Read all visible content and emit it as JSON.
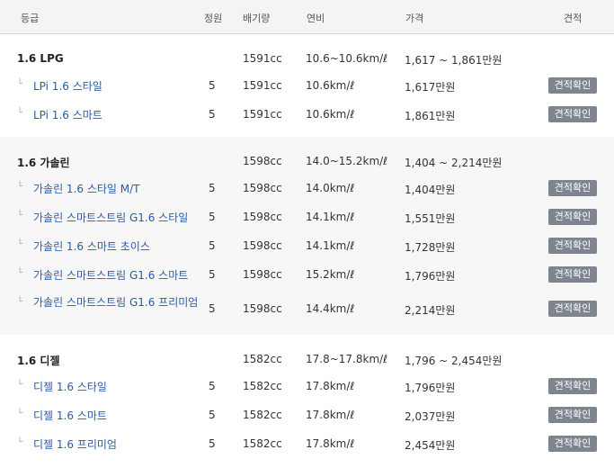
{
  "header": {
    "grade": "등급",
    "seats": "정원",
    "displacement": "배기량",
    "fuel_economy": "연비",
    "price": "가격",
    "quote": "견적"
  },
  "groups": [
    {
      "title": "1.6 LPG",
      "displacement": "1591cc",
      "fuel_economy": "10.6~10.6km/ℓ",
      "price": "1,617 ~ 1,861만원",
      "trims": [
        {
          "name": "LPi 1.6 스타일",
          "seats": "5",
          "displacement": "1591cc",
          "fuel_economy": "10.6km/ℓ",
          "price": "1,617만원",
          "quote": "견적확인"
        },
        {
          "name": "LPi 1.6 스마트",
          "seats": "5",
          "displacement": "1591cc",
          "fuel_economy": "10.6km/ℓ",
          "price": "1,861만원",
          "quote": "견적확인"
        }
      ]
    },
    {
      "title": "1.6 가솔린",
      "displacement": "1598cc",
      "fuel_economy": "14.0~15.2km/ℓ",
      "price": "1,404 ~ 2,214만원",
      "trims": [
        {
          "name": "가솔린 1.6 스타일 M/T",
          "seats": "5",
          "displacement": "1598cc",
          "fuel_economy": "14.0km/ℓ",
          "price": "1,404만원",
          "quote": "견적확인"
        },
        {
          "name": "가솔린 스마트스트림 G1.6 스타일",
          "seats": "5",
          "displacement": "1598cc",
          "fuel_economy": "14.1km/ℓ",
          "price": "1,551만원",
          "quote": "견적확인"
        },
        {
          "name": "가솔린 1.6 스마트 초이스",
          "seats": "5",
          "displacement": "1598cc",
          "fuel_economy": "14.1km/ℓ",
          "price": "1,728만원",
          "quote": "견적확인"
        },
        {
          "name": "가솔린 스마트스트림 G1.6 스마트",
          "seats": "5",
          "displacement": "1598cc",
          "fuel_economy": "15.2km/ℓ",
          "price": "1,796만원",
          "quote": "견적확인"
        },
        {
          "name": "가솔린 스마트스트림 G1.6 프리미엄",
          "seats": "5",
          "displacement": "1598cc",
          "fuel_economy": "14.4km/ℓ",
          "price": "2,214만원",
          "quote": "견적확인"
        }
      ]
    },
    {
      "title": "1.6 디젤",
      "displacement": "1582cc",
      "fuel_economy": "17.8~17.8km/ℓ",
      "price": "1,796 ~ 2,454만원",
      "trims": [
        {
          "name": "디젤 1.6 스타일",
          "seats": "5",
          "displacement": "1582cc",
          "fuel_economy": "17.8km/ℓ",
          "price": "1,796만원",
          "quote": "견적확인"
        },
        {
          "name": "디젤 1.6 스마트",
          "seats": "5",
          "displacement": "1582cc",
          "fuel_economy": "17.8km/ℓ",
          "price": "2,037만원",
          "quote": "견적확인"
        },
        {
          "name": "디젤 1.6 프리미엄",
          "seats": "5",
          "displacement": "1582cc",
          "fuel_economy": "17.8km/ℓ",
          "price": "2,454만원",
          "quote": "견적확인"
        }
      ]
    }
  ]
}
